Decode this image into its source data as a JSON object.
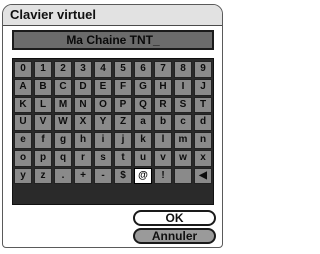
{
  "dialog": {
    "title": "Clavier virtuel",
    "input_value": "Ma Chaine TNT_"
  },
  "keyboard": {
    "rows": [
      [
        "0",
        "1",
        "2",
        "3",
        "4",
        "5",
        "6",
        "7",
        "8",
        "9"
      ],
      [
        "A",
        "B",
        "C",
        "D",
        "E",
        "F",
        "G",
        "H",
        "I",
        "J"
      ],
      [
        "K",
        "L",
        "M",
        "N",
        "O",
        "P",
        "Q",
        "R",
        "S",
        "T"
      ],
      [
        "U",
        "V",
        "W",
        "X",
        "Y",
        "Z",
        "a",
        "b",
        "c",
        "d"
      ],
      [
        "e",
        "f",
        "g",
        "h",
        "i",
        "j",
        "k",
        "l",
        "m",
        "n"
      ],
      [
        "o",
        "p",
        "q",
        "r",
        "s",
        "t",
        "u",
        "v",
        "w",
        "x"
      ],
      [
        "y",
        "z",
        ".",
        "+",
        "-",
        "$",
        "@",
        "!",
        "",
        "◀"
      ]
    ],
    "selected_key": "@"
  },
  "buttons": {
    "ok_label": "OK",
    "cancel_label": "Annuler"
  },
  "colors": {
    "key_background": "#8a8a8a",
    "grid_background": "#2a2a2a",
    "selected_key_background": "#ffffff",
    "title_bar": "#e2e2e2"
  }
}
